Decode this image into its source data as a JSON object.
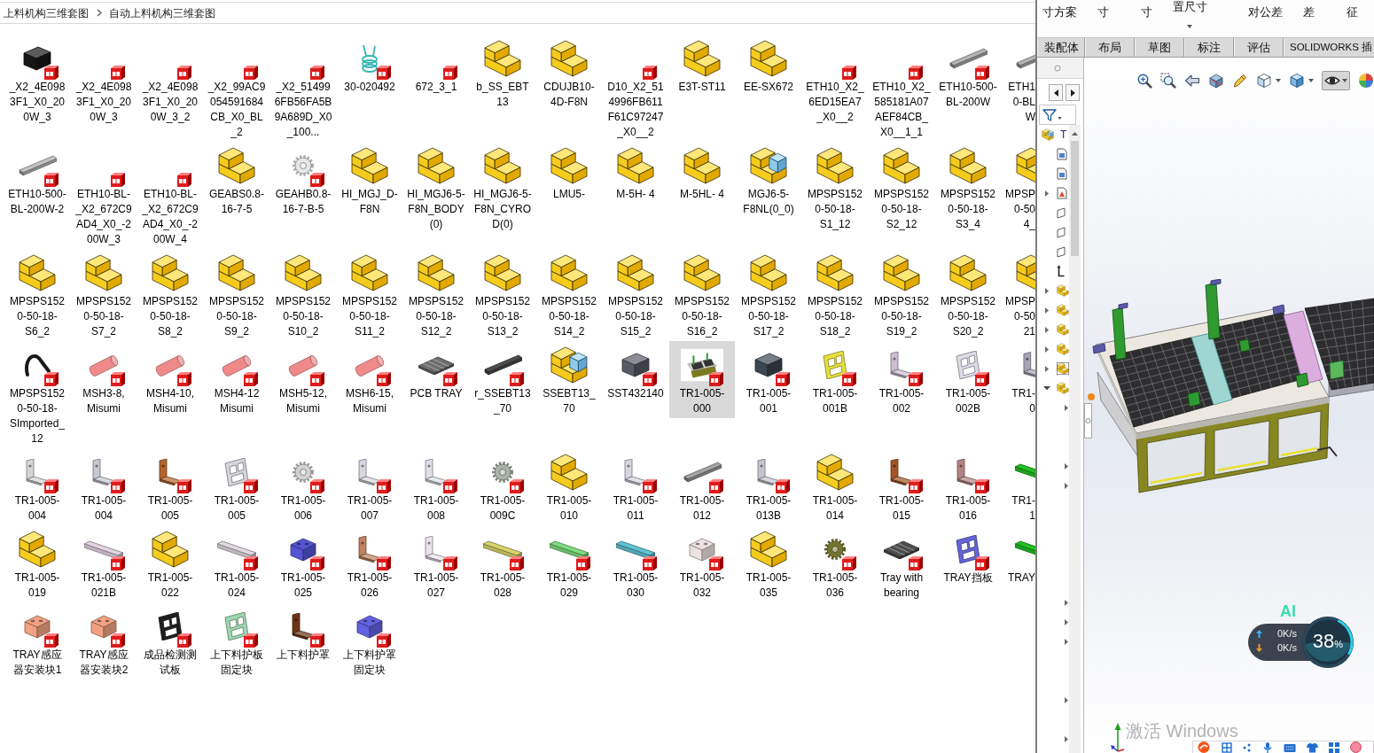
{
  "explorer": {
    "breadcrumbs": [
      "上料机构三维套图",
      "自动上料机构三维套图"
    ],
    "files": [
      {
        "label": "_X2_4E0983F1_X0_200W_3",
        "kind": "box",
        "color": "#151515",
        "selected": false
      },
      {
        "label": "_X2_4E0983F1_X0_200W_3",
        "kind": "blank",
        "selected": false
      },
      {
        "label": "_X2_4E0983F1_X0_200W_3_2",
        "kind": "blank",
        "selected": false
      },
      {
        "label": "_X2_99AC9054591684CB_X0_BL_2",
        "kind": "blank",
        "selected": false
      },
      {
        "label": "_X2_514996FB56FA5B9A689D_X0_100...",
        "kind": "blank",
        "selected": false
      },
      {
        "label": "30-020492",
        "kind": "coil",
        "color": "#35b5b5",
        "selected": false
      },
      {
        "label": "672_3_1",
        "kind": "blank",
        "selected": false
      },
      {
        "label": "b_SS_EBT13",
        "kind": "assembly",
        "selected": false
      },
      {
        "label": "CDUJB10-4D-F8N",
        "kind": "assembly",
        "selected": false
      },
      {
        "label": "D10_X2_514996FB611F61C97247_X0__2",
        "kind": "blank",
        "selected": false
      },
      {
        "label": "E3T-ST11",
        "kind": "assembly",
        "selected": false
      },
      {
        "label": "EE-SX672",
        "kind": "assembly",
        "selected": false
      },
      {
        "label": "ETH10_X2_6ED15EA7_X0__2",
        "kind": "blank",
        "selected": false
      },
      {
        "label": "ETH10_X2_585181A07AEF84CB_X0__1_1",
        "kind": "blank",
        "selected": false
      },
      {
        "label": "ETH10-500-BL-200W",
        "kind": "rail",
        "color": "#b4b4b4",
        "selected": false
      },
      {
        "label": "ETH10-500-BL-200W-2",
        "kind": "rail",
        "color": "#c4c4c4",
        "selected": false
      },
      {
        "label": "ETH10-BL-_X2_672C9AD4_X0_-200W_3",
        "kind": "blank",
        "selected": false
      },
      {
        "label": "ETH10-BL-_X2_672C9AD4_X0_-200W_4",
        "kind": "blank",
        "selected": false
      },
      {
        "label": "GEABS0.8-16-7-5",
        "kind": "assembly",
        "selected": false
      },
      {
        "label": "GEAHB0.8-16-7-B-5",
        "kind": "gear",
        "color": "#e6e6e6",
        "selected": false
      },
      {
        "label": "HI_MGJ_D-F8N",
        "kind": "assembly",
        "selected": false
      },
      {
        "label": "HI_MGJ6-5-F8N_BODY(0)",
        "kind": "assembly",
        "selected": false
      },
      {
        "label": "HI_MGJ6-5-F8N_CYROD(0)",
        "kind": "assembly",
        "selected": false
      },
      {
        "label": "LMU5-",
        "kind": "assembly",
        "selected": false
      },
      {
        "label": "M-5H- 4",
        "kind": "assembly",
        "selected": false
      },
      {
        "label": "M-5HL- 4",
        "kind": "assembly",
        "selected": false
      },
      {
        "label": "MGJ6-5-F8NL(0_0)",
        "kind": "linked",
        "selected": false
      },
      {
        "label": "MPSPS1520-50-18-S1_12",
        "kind": "assembly",
        "selected": false
      },
      {
        "label": "MPSPS1520-50-18-S2_12",
        "kind": "assembly",
        "selected": false
      },
      {
        "label": "MPSPS1520-50-18-S3_4",
        "kind": "assembly",
        "selected": false
      },
      {
        "label": "MPSPS1520-50-18-S6_2",
        "kind": "assembly",
        "selected": false
      },
      {
        "label": "MPSPS1520-50-18-S7_2",
        "kind": "assembly",
        "selected": false
      },
      {
        "label": "MPSPS1520-50-18-S8_2",
        "kind": "assembly",
        "selected": false
      },
      {
        "label": "MPSPS1520-50-18-S9_2",
        "kind": "assembly",
        "selected": false
      },
      {
        "label": "MPSPS1520-50-18-S10_2",
        "kind": "assembly",
        "selected": false
      },
      {
        "label": "MPSPS1520-50-18-S11_2",
        "kind": "assembly",
        "selected": false
      },
      {
        "label": "MPSPS1520-50-18-S12_2",
        "kind": "assembly",
        "selected": false
      },
      {
        "label": "MPSPS1520-50-18-S13_2",
        "kind": "assembly",
        "selected": false
      },
      {
        "label": "MPSPS1520-50-18-S14_2",
        "kind": "assembly",
        "selected": false
      },
      {
        "label": "MPSPS1520-50-18-S15_2",
        "kind": "assembly",
        "selected": false
      },
      {
        "label": "MPSPS1520-50-18-S16_2",
        "kind": "assembly",
        "selected": false
      },
      {
        "label": "MPSPS1520-50-18-S17_2",
        "kind": "assembly",
        "selected": false
      },
      {
        "label": "MPSPS1520-50-18-S18_2",
        "kind": "assembly",
        "selected": false
      },
      {
        "label": "MPSPS1520-50-18-S19_2",
        "kind": "assembly",
        "selected": false
      },
      {
        "label": "MPSPS1520-50-18-S20_2",
        "kind": "assembly",
        "selected": false
      },
      {
        "label": "MPSPS1520-50-18-SImported_12",
        "kind": "hook",
        "color": "#1a1a1a",
        "selected": false
      },
      {
        "label": "MSH3-8, Misumi",
        "kind": "cylinder",
        "color": "#f08a8a",
        "selected": false
      },
      {
        "label": "MSH4-10, Misumi",
        "kind": "cylinder",
        "color": "#f08a8a",
        "selected": false
      },
      {
        "label": "MSH4-12 Misumi",
        "kind": "cylinder",
        "color": "#f08a8a",
        "selected": false
      },
      {
        "label": "MSH5-12, Misumi",
        "kind": "cylinder",
        "color": "#f08a8a",
        "selected": false
      },
      {
        "label": "MSH6-15, Misumi",
        "kind": "cylinder",
        "color": "#f08a8a",
        "selected": false
      },
      {
        "label": "PCB TRAY",
        "kind": "tray",
        "color": "#6e6e6e",
        "selected": false
      },
      {
        "label": "r_SSEBT13_70",
        "kind": "rail",
        "color": "#4c4c4c",
        "selected": false
      },
      {
        "label": "SSEBT13_70",
        "kind": "linked",
        "selected": false
      },
      {
        "label": "SST432140",
        "kind": "box",
        "color": "#5a5a66",
        "selected": false
      },
      {
        "label": "TR1-005-000",
        "kind": "machine",
        "selected": true
      },
      {
        "label": "TR1-005-001",
        "kind": "box",
        "color": "#3c4650",
        "selected": false
      },
      {
        "label": "TR1-005-001B",
        "kind": "plate",
        "color": "#e6e03a",
        "selected": false
      },
      {
        "label": "TR1-005-002",
        "kind": "bracket",
        "color": "#cbbfd0",
        "selected": false
      },
      {
        "label": "TR1-005-002B",
        "kind": "plate",
        "color": "#dcdce6",
        "selected": false
      },
      {
        "label": "TR1-005-004",
        "kind": "bracket",
        "color": "#d6d6d6",
        "selected": false
      },
      {
        "label": "TR1-005-004",
        "kind": "bracket",
        "color": "#c6c8d2",
        "selected": false
      },
      {
        "label": "TR1-005-005",
        "kind": "bracket",
        "color": "#b4652c",
        "selected": false
      },
      {
        "label": "TR1-005-005",
        "kind": "plate",
        "color": "#d4d4de",
        "selected": false
      },
      {
        "label": "TR1-005-006",
        "kind": "gear",
        "color": "#d2d2d2",
        "selected": false
      },
      {
        "label": "TR1-005-007",
        "kind": "bracket",
        "color": "#d8d8e2",
        "selected": false
      },
      {
        "label": "TR1-005-008",
        "kind": "bracket",
        "color": "#e0e0ea",
        "selected": false
      },
      {
        "label": "TR1-005-009C",
        "kind": "gear",
        "color": "#aab4a4",
        "selected": false
      },
      {
        "label": "TR1-005-010",
        "kind": "assembly",
        "selected": false
      },
      {
        "label": "TR1-005-011",
        "kind": "bracket",
        "color": "#d6d6e0",
        "selected": false
      },
      {
        "label": "TR1-005-012",
        "kind": "rail",
        "color": "#a4a4a4",
        "selected": false
      },
      {
        "label": "TR1-005-013B",
        "kind": "bracket",
        "color": "#c6c6d0",
        "selected": false
      },
      {
        "label": "TR1-005-014",
        "kind": "assembly",
        "selected": false
      },
      {
        "label": "TR1-005-015",
        "kind": "bracket",
        "color": "#a45424",
        "selected": false
      },
      {
        "label": "TR1-005-016",
        "kind": "bracket",
        "color": "#b48484",
        "selected": false
      },
      {
        "label": "TR1-005-019",
        "kind": "assembly",
        "selected": false
      },
      {
        "label": "TR1-005-021B",
        "kind": "bar",
        "color": "#e2d4e2",
        "selected": false
      },
      {
        "label": "TR1-005-022",
        "kind": "assembly",
        "selected": false
      },
      {
        "label": "TR1-005-024",
        "kind": "bar",
        "color": "#e2dae2",
        "selected": false
      },
      {
        "label": "TR1-005-025",
        "kind": "block",
        "color": "#5454d4",
        "selected": false
      },
      {
        "label": "TR1-005-026",
        "kind": "bracket",
        "color": "#c2825e",
        "selected": false
      },
      {
        "label": "TR1-005-027",
        "kind": "bracket",
        "color": "#ece2ec",
        "selected": false
      },
      {
        "label": "TR1-005-028",
        "kind": "bar",
        "color": "#d8d46c",
        "selected": false
      },
      {
        "label": "TR1-005-029",
        "kind": "bar",
        "color": "#7ede7e",
        "selected": false
      },
      {
        "label": "TR1-005-030",
        "kind": "bar",
        "color": "#5ec4d2",
        "selected": false
      },
      {
        "label": "TR1-005-032",
        "kind": "block",
        "color": "#ece2e2",
        "selected": false
      },
      {
        "label": "TR1-005-035",
        "kind": "assembly",
        "selected": false
      },
      {
        "label": "TR1-005-036",
        "kind": "gear",
        "color": "#74742e",
        "selected": false
      },
      {
        "label": "Tray with bearing",
        "kind": "tray",
        "color": "#4e4e4e",
        "selected": false
      },
      {
        "label": "TRAY挡板",
        "kind": "plate",
        "color": "#6464d8",
        "selected": false
      },
      {
        "label": "TRAY感应器安装块1",
        "kind": "block",
        "color": "#f2a282",
        "selected": false
      },
      {
        "label": "TRAY感应器安装块2",
        "kind": "block",
        "color": "#f2a282",
        "selected": false
      },
      {
        "label": "成品检测测试板",
        "kind": "plate",
        "color": "#1e1e1e",
        "selected": false
      },
      {
        "label": "上下料护板固定块",
        "kind": "plate",
        "color": "#9ed6b0",
        "selected": false
      },
      {
        "label": "上下料护罩",
        "kind": "bracket",
        "color": "#6c3414",
        "selected": false
      },
      {
        "label": "上下料护罩固定块",
        "kind": "block",
        "color": "#6262e2",
        "selected": false
      }
    ],
    "cut_column": [
      {
        "lines": [
          "ETH1",
          "0-BL",
          "W"
        ],
        "kind": "rail",
        "color": "#b4b4b4",
        "selected": false
      },
      {
        "lines": [
          "MPSP",
          "0-50",
          "4_"
        ],
        "kind": "assembly",
        "selected": false
      },
      {
        "lines": [
          "MPSP",
          "0-50",
          "21"
        ],
        "kind": "assembly",
        "selected": false
      },
      {
        "lines": [
          "TR1-",
          "0"
        ],
        "kind": "bracket",
        "color": "#a4a4b4",
        "selected": false
      },
      {
        "lines": [
          "TR1-",
          "1"
        ],
        "kind": "bar",
        "color": "#22c022",
        "selected": false
      },
      {
        "lines": [
          "TRAY"
        ],
        "kind": "bar",
        "color": "#22c022",
        "selected": false
      }
    ]
  },
  "solidworks": {
    "ribbon": [
      {
        "label": "寸方案",
        "menu": false
      },
      {
        "label": "寸",
        "menu": false
      },
      {
        "label": "寸",
        "menu": false
      },
      {
        "label": "置尺寸",
        "menu": true
      },
      {
        "label": "对公差",
        "menu": false
      },
      {
        "label": "差",
        "menu": false
      },
      {
        "label": "征",
        "menu": false
      }
    ],
    "tabs": [
      {
        "label": "装配体",
        "selected": false
      },
      {
        "label": "布局",
        "selected": false
      },
      {
        "label": "草图",
        "selected": false
      },
      {
        "label": "标注",
        "selected": false
      },
      {
        "label": "评估",
        "selected": false
      },
      {
        "label": "SOLIDWORKS 插",
        "selected": false
      }
    ],
    "feature_tree": {
      "root": {
        "label": "T",
        "selected": false
      },
      "items": [
        {
          "kind": "doc",
          "selected": false
        },
        {
          "kind": "doc",
          "selected": false
        },
        {
          "kind": "annotation",
          "expanded": false,
          "selected": false
        },
        {
          "kind": "plane",
          "selected": false
        },
        {
          "kind": "plane",
          "selected": false
        },
        {
          "kind": "plane",
          "selected": false
        },
        {
          "kind": "origin",
          "selected": false
        },
        {
          "kind": "part",
          "expanded": false,
          "selected": false
        },
        {
          "kind": "part",
          "expanded": false,
          "selected": false
        },
        {
          "kind": "part",
          "expanded": false,
          "selected": false
        },
        {
          "kind": "part",
          "expanded": false,
          "selected": false
        },
        {
          "kind": "part",
          "expanded": false,
          "selected": true
        },
        {
          "kind": "part",
          "expanded": true,
          "selected": false,
          "children": [
            {
              "kind": "folder",
              "expanded": false
            },
            {
              "kind": "part"
            },
            {
              "kind": "part"
            },
            {
              "kind": "folder",
              "expanded": false
            },
            {
              "kind": "folder",
              "expanded": false
            },
            {
              "kind": "part"
            },
            {
              "kind": "part"
            },
            {
              "kind": "part"
            },
            {
              "kind": "part"
            },
            {
              "kind": "part"
            },
            {
              "kind": "folder",
              "expanded": false
            },
            {
              "kind": "folder",
              "expanded": false
            },
            {
              "kind": "folder",
              "expanded": false
            },
            {
              "kind": "part"
            },
            {
              "kind": "part"
            },
            {
              "kind": "folder",
              "expanded": false
            },
            {
              "kind": "part"
            },
            {
              "kind": "folder",
              "expanded": false
            }
          ]
        }
      ]
    },
    "view_toolbar": [
      {
        "kind": "fit",
        "menu": false,
        "pressed": false
      },
      {
        "kind": "area",
        "menu": false,
        "pressed": false
      },
      {
        "kind": "previous",
        "menu": false,
        "pressed": false
      },
      {
        "kind": "section",
        "menu": false,
        "pressed": false
      },
      {
        "kind": "annotation",
        "menu": false,
        "pressed": false
      },
      {
        "kind": "orientation",
        "menu": true,
        "pressed": false
      },
      {
        "kind": "display",
        "menu": true,
        "pressed": false
      },
      {
        "kind": "visibility",
        "menu": true,
        "pressed": true
      },
      {
        "kind": "appearance",
        "menu": false,
        "pressed": false
      }
    ],
    "speed_widget": {
      "badge": "AI",
      "upload": "0K/s",
      "download": "0K/s",
      "value": "38",
      "unit": "%"
    },
    "activation_notice": "激活 Windows"
  }
}
